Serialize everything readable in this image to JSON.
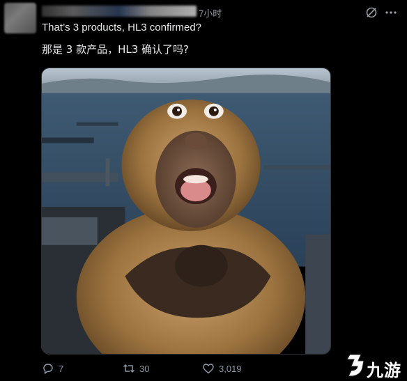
{
  "post": {
    "timestamp": "7小时",
    "text_en": "That’s 3 products, HL3 confirmed?",
    "text_zh": "那是 3 款产品，HL3 确认了吗?",
    "media": {
      "description_icon": "monkey-photo"
    }
  },
  "actions": {
    "replies": "7",
    "reposts": "30",
    "likes": "3,019"
  },
  "watermark": {
    "text": "九游",
    "logo_icon": "jiuyou-logo"
  },
  "colors": {
    "background": "#000000",
    "text": "#e7e9ea",
    "muted": "#8b98a5"
  }
}
